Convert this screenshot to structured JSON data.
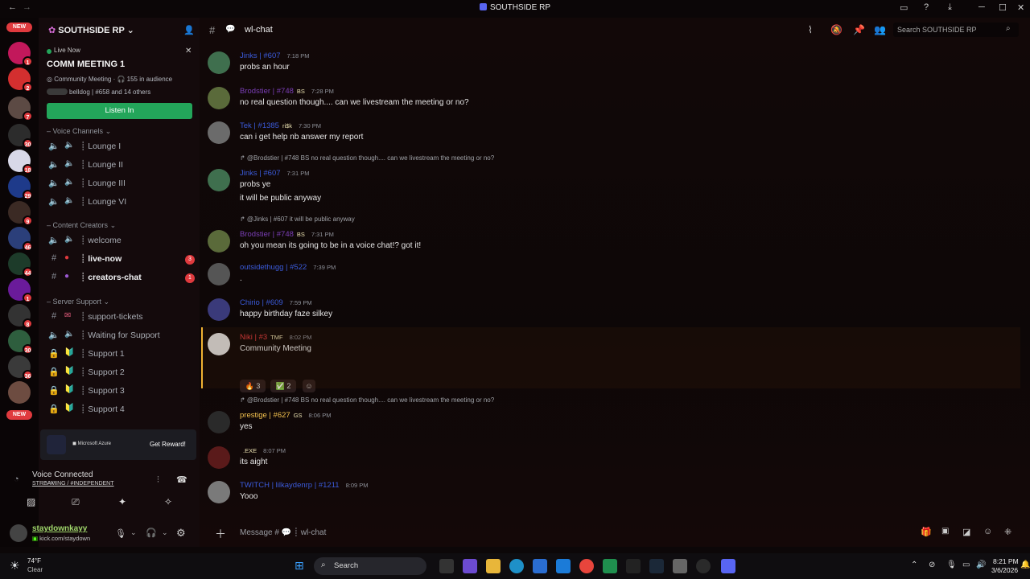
{
  "window": {
    "title": "SOUTHSIDE RP"
  },
  "server": {
    "name": "SOUTHSIDE RP"
  },
  "rail": {
    "new_top": "NEW",
    "new_bottom": "NEW",
    "badges": [
      "1",
      "2",
      "7",
      "30",
      "18",
      "29",
      "9",
      "46",
      "44",
      "1",
      "8",
      "30",
      "36"
    ]
  },
  "live": {
    "tag": "Live Now",
    "title": "COMM MEETING 1",
    "meta": "Community Meeting · 🎧 155 in audience",
    "host": "belldog | #658 and 14 others",
    "button": "Listen In"
  },
  "categories": {
    "voice": "Voice Channels",
    "content": "Content Creators",
    "support": "Server Support"
  },
  "channels": [
    {
      "label": "Lounge I",
      "icon": "speaker-icon"
    },
    {
      "label": "Lounge II",
      "icon": "speaker-icon"
    },
    {
      "label": "Lounge III",
      "icon": "speaker-icon"
    },
    {
      "label": "Lounge VI",
      "icon": "speaker-icon"
    },
    {
      "label": "welcome",
      "icon": "speaker-icon"
    },
    {
      "label": "live-now",
      "icon": "hash-icon",
      "count": "3"
    },
    {
      "label": "creators-chat",
      "icon": "hash-icon",
      "count": "1"
    },
    {
      "label": "support-tickets",
      "icon": "hash-icon"
    },
    {
      "label": "Waiting for Support",
      "icon": "speaker-icon"
    },
    {
      "label": "Support 1",
      "icon": "lock-icon"
    },
    {
      "label": "Support 2",
      "icon": "lock-icon"
    },
    {
      "label": "Support 3",
      "icon": "lock-icon"
    },
    {
      "label": "Support 4",
      "icon": "lock-icon"
    }
  ],
  "promo": {
    "button": "Get Reward!"
  },
  "voice": {
    "status": "Voice Connected",
    "channel": "STREAMING / #INDEPENDENT"
  },
  "user": {
    "name": "staydownkayy",
    "status": "kick.com/staydown"
  },
  "header": {
    "channel": "wl-chat",
    "search_placeholder": "Search SOUTHSIDE RP"
  },
  "messages": [
    {
      "user": "Jinks | #607",
      "time": "7:18 PM",
      "text": "probs an hour",
      "color": "#3b5bdb"
    },
    {
      "user": "Brodstier | #748",
      "tag": "BS",
      "time": "7:28 PM",
      "text": "no real question though.... can we livestream the meeting or no?",
      "color": "#7b3fb8"
    },
    {
      "user": "Tek | #1385",
      "tag": "ri$k",
      "time": "7:30 PM",
      "text": "can i get help nb answer my report",
      "color": "#3b5bdb"
    },
    {
      "reply": "@Brodstier | #748 BS no real question though.... can we livestream the meeting or no?",
      "user": "Jinks | #607",
      "time": "7:31 PM",
      "text": "probs ye",
      "text2": "it will be public anyway",
      "color": "#3b5bdb"
    },
    {
      "reply": "@Jinks | #607 it will be public anyway",
      "user": "Brodstier | #748",
      "tag": "BS",
      "time": "7:31 PM",
      "text": "oh you mean its going to be in a voice chat!? got it!",
      "color": "#7b3fb8"
    },
    {
      "user": "outsidethugg | #522",
      "time": "7:39 PM",
      "text": ".",
      "color": "#3b5bdb"
    },
    {
      "user": "Chirio | #609",
      "time": "7:59 PM",
      "text": "happy birthday faze silkey",
      "color": "#3b5bdb"
    },
    {
      "user": "Niki | #3",
      "tag": "TMF",
      "time": "8:02 PM",
      "text": "Community Meeting",
      "color": "#e03a3e",
      "reactions": [
        "3",
        "2"
      ]
    },
    {
      "reply": "@Brodstier | #748 BS no real question though.... can we livestream the meeting or no?",
      "user": "prestige | #627",
      "tag": "GS",
      "time": "8:06 PM",
      "text": "yes",
      "color": "#f2c14e"
    },
    {
      "user": "",
      "tag": ".EXE",
      "time": "8:07 PM",
      "text": "its aight",
      "color": "#3b5bdb"
    },
    {
      "user": "TWITCH | lilkaydenrp | #1211",
      "time": "8:09 PM",
      "text": "Yooo",
      "color": "#3b5bdb"
    }
  ],
  "composer": {
    "placeholder": "Message # 💬 ┊ wl-chat"
  },
  "taskbar": {
    "weather_temp": "74°F",
    "weather_desc": "Clear",
    "search": "Search",
    "time": "8:21 PM",
    "date": "3/6/2026"
  },
  "colors": {
    "accent": "#23a55a",
    "danger": "#e03a3e",
    "link": "#5865f2"
  }
}
